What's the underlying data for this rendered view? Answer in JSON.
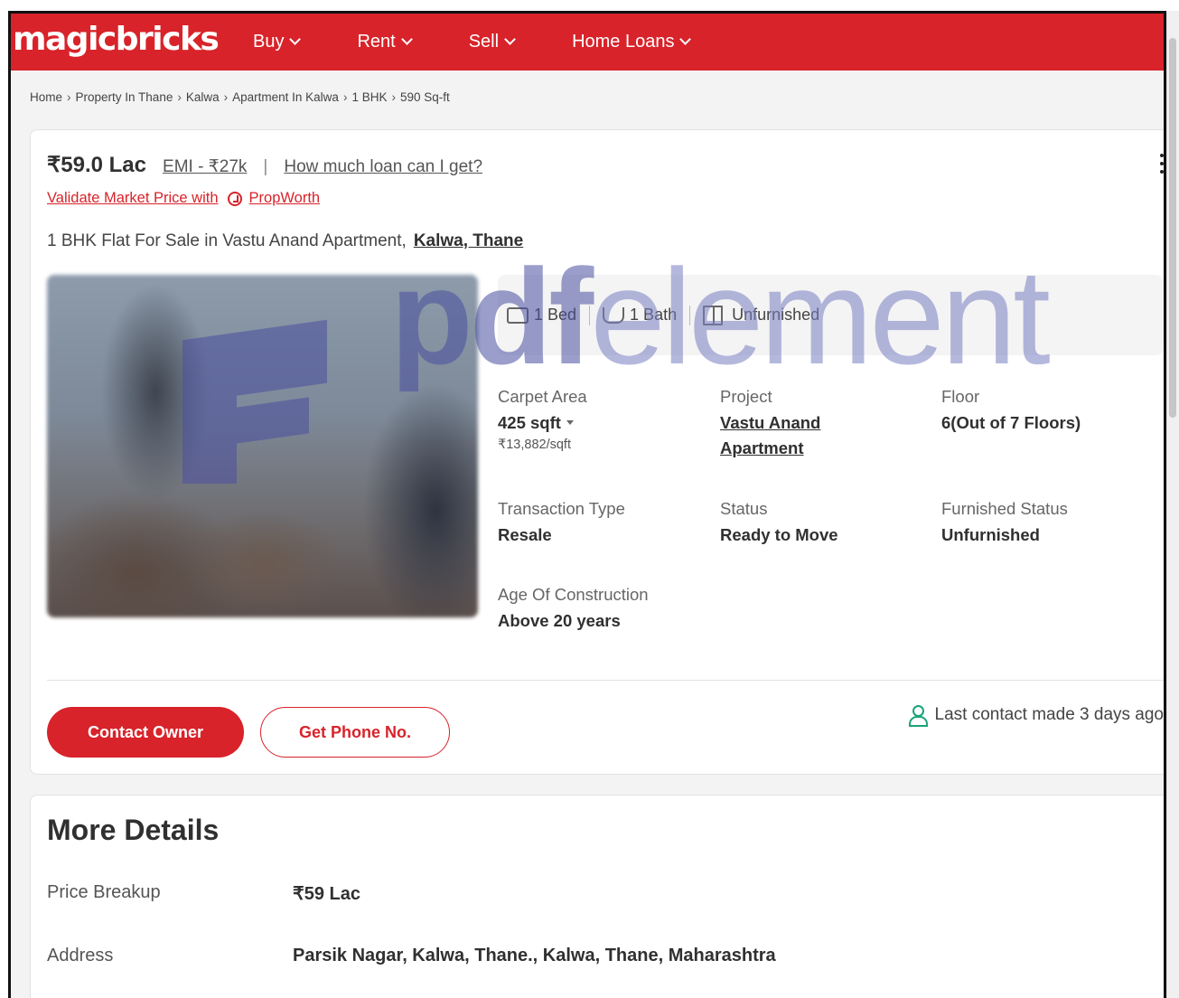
{
  "header": {
    "logo": "magicbricks",
    "nav": [
      {
        "label": "Buy"
      },
      {
        "label": "Rent"
      },
      {
        "label": "Sell"
      },
      {
        "label": "Home Loans"
      }
    ]
  },
  "breadcrumb": [
    "Home",
    "Property In Thane",
    "Kalwa",
    "Apartment In Kalwa",
    "1 BHK",
    "590 Sq-ft"
  ],
  "listing": {
    "price": "₹59.0 Lac",
    "emi": "EMI - ₹27k",
    "separator": "|",
    "loan_link": "How much loan can I get?",
    "validate_text": "Validate Market Price with",
    "propworth": "PropWorth",
    "title": "1 BHK Flat For Sale in Vastu Anand Apartment,",
    "locality": "Kalwa, Thane",
    "features": {
      "bed": "1 Bed",
      "bath": "1 Bath",
      "furnishing": "Unfurnished"
    },
    "specs": {
      "carpet_area": {
        "label": "Carpet Area",
        "value": "425 sqft",
        "sub": "₹13,882/sqft"
      },
      "project": {
        "label": "Project",
        "value_line1": "Vastu Anand",
        "value_line2": "Apartment"
      },
      "floor": {
        "label": "Floor",
        "value": "6(Out of 7 Floors)"
      },
      "transaction": {
        "label": "Transaction Type",
        "value": "Resale"
      },
      "status": {
        "label": "Status",
        "value": "Ready to Move"
      },
      "furnished": {
        "label": "Furnished Status",
        "value": "Unfurnished"
      },
      "age": {
        "label": "Age Of Construction",
        "value": "Above 20 years"
      }
    },
    "actions": {
      "contact_owner": "Contact Owner",
      "get_phone": "Get Phone No.",
      "last_contact": "Last contact made 3 days ago"
    }
  },
  "more_details": {
    "title": "More Details",
    "rows": [
      {
        "key": "Price Breakup",
        "value": "₹59 Lac"
      },
      {
        "key": "Address",
        "value": "Parsik Nagar, Kalwa, Thane., Kalwa, Thane, Maharashtra"
      }
    ]
  },
  "watermark": {
    "text_bold": "pdf",
    "text_light": "element"
  },
  "colors": {
    "brand_red": "#d8232a",
    "accent_green": "#1aa37a",
    "watermark": "#4a4f9f"
  }
}
